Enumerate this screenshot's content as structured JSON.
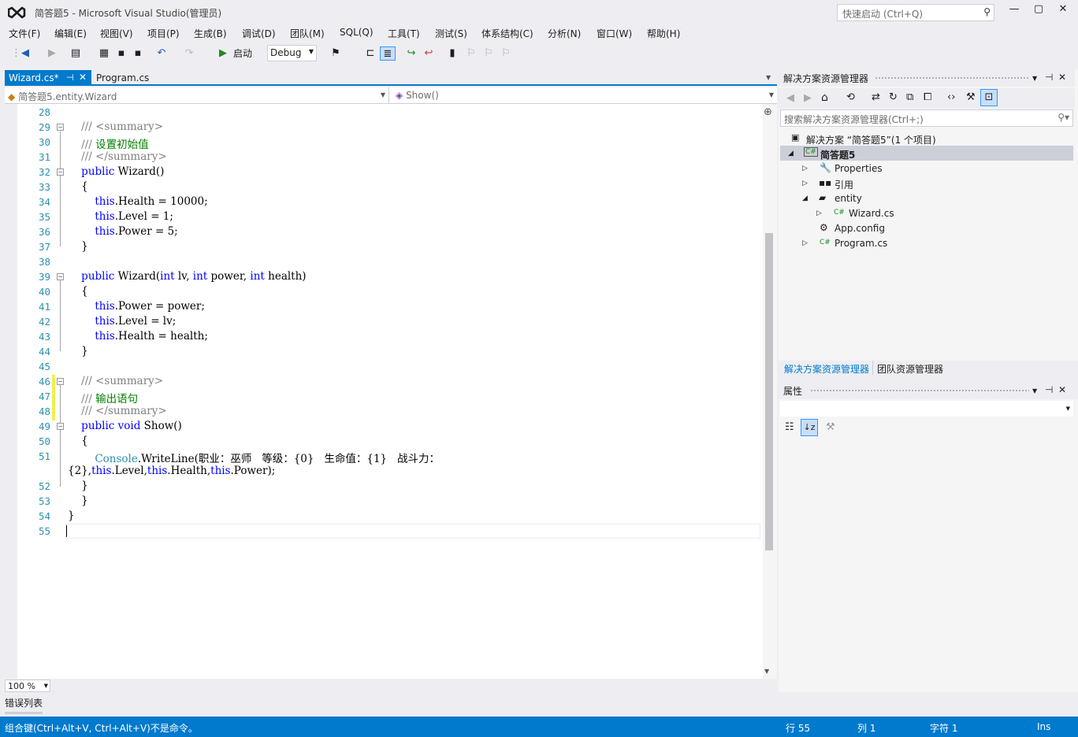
{
  "window": {
    "title": "简答题5 - Microsoft Visual Studio(管理员)",
    "quick_launch_placeholder": "快速启动 (Ctrl+Q)"
  },
  "menu": [
    "文件(F)",
    "编辑(E)",
    "视图(V)",
    "项目(P)",
    "生成(B)",
    "调试(D)",
    "团队(M)",
    "SQL(Q)",
    "工具(T)",
    "测试(S)",
    "体系结构(C)",
    "分析(N)",
    "窗口(W)",
    "帮助(H)"
  ],
  "toolbar": {
    "start_label": "启动",
    "config_value": "Debug"
  },
  "tabs": [
    {
      "label": "Wizard.cs*",
      "active": true
    },
    {
      "label": "Program.cs",
      "active": false
    }
  ],
  "navbar": {
    "type_value": "简答题5.entity.Wizard",
    "member_value": "Show()"
  },
  "editor": {
    "zoom": "100 %",
    "lines": [
      {
        "n": "28",
        "t": ""
      },
      {
        "n": "29",
        "t": "        /// <summary>"
      },
      {
        "n": "30",
        "t": "        /// 设置初始值"
      },
      {
        "n": "31",
        "t": "        /// </summary>"
      },
      {
        "n": "32",
        "t": "        public Wizard()"
      },
      {
        "n": "33",
        "t": "        {"
      },
      {
        "n": "34",
        "t": "            this.Health = 10000;"
      },
      {
        "n": "35",
        "t": "            this.Level = 1;"
      },
      {
        "n": "36",
        "t": "            this.Power = 5;"
      },
      {
        "n": "37",
        "t": "        }"
      },
      {
        "n": "38",
        "t": ""
      },
      {
        "n": "39",
        "t": "        public Wizard(int lv, int power, int health)"
      },
      {
        "n": "40",
        "t": "        {"
      },
      {
        "n": "41",
        "t": "            this.Power = power;"
      },
      {
        "n": "42",
        "t": "            this.Level = lv;"
      },
      {
        "n": "43",
        "t": "            this.Health = health;"
      },
      {
        "n": "44",
        "t": "        }"
      },
      {
        "n": "45",
        "t": ""
      },
      {
        "n": "46",
        "t": "        /// <summary>"
      },
      {
        "n": "47",
        "t": "        /// 输出语句"
      },
      {
        "n": "48",
        "t": "        /// </summary>"
      },
      {
        "n": "49",
        "t": "        public void Show()"
      },
      {
        "n": "50",
        "t": "        {"
      },
      {
        "n": "51",
        "t": "            Console.WriteLine(\"职业：巫师   等级：{0}   生命值：{1}   战斗力：{2}\",this.Level,this.Health,this.Power);"
      },
      {
        "n": "52",
        "t": "        }"
      },
      {
        "n": "53",
        "t": "    }"
      },
      {
        "n": "54",
        "t": "}"
      },
      {
        "n": "55",
        "t": ""
      }
    ]
  },
  "solution_explorer": {
    "title": "解决方案资源管理器",
    "search_placeholder": "搜索解决方案资源管理器(Ctrl+;)",
    "solution": "解决方案 “简答题5”(1 个项目)",
    "project": "简答题5",
    "items": {
      "properties": "Properties",
      "references": "引用",
      "entity": "entity",
      "wizard": "Wizard.cs",
      "appconfig": "App.config",
      "program": "Program.cs"
    },
    "tab_se": "解决方案资源管理器",
    "tab_team": "团队资源管理器"
  },
  "properties": {
    "title": "属性"
  },
  "error_list": {
    "label": "错误列表"
  },
  "status": {
    "message": "组合键(Ctrl+Alt+V, Ctrl+Alt+V)不是命令。",
    "row": "行 55",
    "col": "列 1",
    "ch": "字符 1",
    "ins": "Ins"
  },
  "colors": {
    "accent": "#007acc",
    "keyword": "#0000ff",
    "comment": "#008000",
    "string": "#a31515",
    "type": "#2b91af"
  }
}
